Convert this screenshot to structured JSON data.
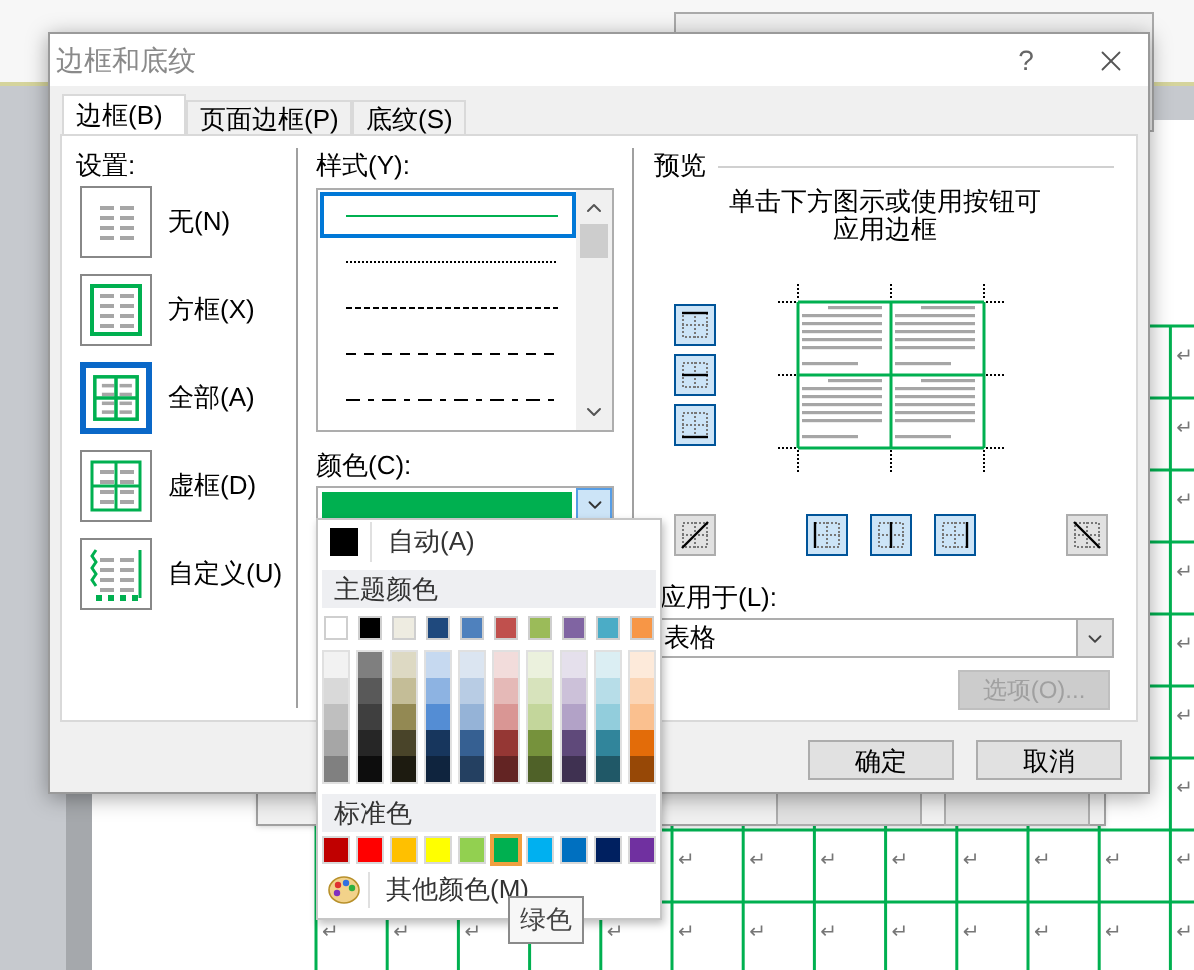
{
  "window": {
    "title": "边框和底纹",
    "help": "?"
  },
  "tabs": [
    {
      "label": "边框(B)",
      "selected": true
    },
    {
      "label": "页面边框(P)",
      "selected": false
    },
    {
      "label": "底纹(S)",
      "selected": false
    }
  ],
  "settings": {
    "label": "设置:",
    "items": [
      {
        "kind": "none",
        "label": "无(N)",
        "selected": false
      },
      {
        "kind": "box",
        "label": "方框(X)",
        "selected": false
      },
      {
        "kind": "all",
        "label": "全部(A)",
        "selected": true
      },
      {
        "kind": "grid",
        "label": "虚框(D)",
        "selected": false
      },
      {
        "kind": "custom",
        "label": "自定义(U)",
        "selected": false
      }
    ]
  },
  "style": {
    "label": "样式(Y):",
    "lines": [
      {
        "kind": "solid",
        "selected": true
      },
      {
        "kind": "dotted",
        "selected": false
      },
      {
        "kind": "fine-dash",
        "selected": false
      },
      {
        "kind": "dashed",
        "selected": false
      },
      {
        "kind": "dash-dot",
        "selected": false
      }
    ]
  },
  "color": {
    "label": "颜色(C):",
    "color": "#00b050"
  },
  "preview": {
    "label": "预览",
    "instruction": [
      "单击下方图示或使用按钮可",
      "应用边框"
    ],
    "side_buttons": [
      {
        "kind": "top",
        "pressed": true
      },
      {
        "kind": "inside-horizontal",
        "pressed": true
      },
      {
        "kind": "bottom",
        "pressed": true
      }
    ],
    "bottom_buttons": [
      {
        "kind": "diagonal-up",
        "pressed": false
      },
      {
        "kind": "left",
        "pressed": true
      },
      {
        "kind": "inside-vertical",
        "pressed": true
      },
      {
        "kind": "right",
        "pressed": true
      },
      {
        "kind": "diagonal-down",
        "pressed": false
      }
    ]
  },
  "apply_to": {
    "label": "应用于(L):",
    "value": "表格"
  },
  "options_button": {
    "label": "选项(O)...",
    "disabled": true
  },
  "buttons": [
    "确定",
    "取消"
  ],
  "color_menu": {
    "auto": {
      "label": "自动(A)",
      "color": "#000000"
    },
    "theme_label": "主题颜色",
    "theme": [
      {
        "color": "#ffffff",
        "shades": [
          {
            "color": "#f2f2f2"
          },
          {
            "color": "#d9d9d9"
          },
          {
            "color": "#bfbfbf"
          },
          {
            "color": "#a6a6a6"
          },
          {
            "color": "#808080"
          }
        ]
      },
      {
        "color": "#000000",
        "shades": [
          {
            "color": "#7f7f7f"
          },
          {
            "color": "#595959"
          },
          {
            "color": "#3f3f3f"
          },
          {
            "color": "#262626"
          },
          {
            "color": "#0d0d0d"
          }
        ]
      },
      {
        "color": "#eeece1",
        "shades": [
          {
            "color": "#ddd9c3"
          },
          {
            "color": "#c4bd97"
          },
          {
            "color": "#938953"
          },
          {
            "color": "#494429"
          },
          {
            "color": "#1d1b10"
          }
        ]
      },
      {
        "color": "#1f497d",
        "shades": [
          {
            "color": "#c6d9f0"
          },
          {
            "color": "#8db3e2"
          },
          {
            "color": "#548dd4"
          },
          {
            "color": "#17365d"
          },
          {
            "color": "#0f243e"
          }
        ]
      },
      {
        "color": "#4f81bd",
        "shades": [
          {
            "color": "#dbe5f1"
          },
          {
            "color": "#b8cce4"
          },
          {
            "color": "#95b3d7"
          },
          {
            "color": "#366092"
          },
          {
            "color": "#244061"
          }
        ]
      },
      {
        "color": "#c0504d",
        "shades": [
          {
            "color": "#f2dcdb"
          },
          {
            "color": "#e5b9b7"
          },
          {
            "color": "#d99694"
          },
          {
            "color": "#953734"
          },
          {
            "color": "#632423"
          }
        ]
      },
      {
        "color": "#9bbb59",
        "shades": [
          {
            "color": "#ebf1dd"
          },
          {
            "color": "#d7e3bc"
          },
          {
            "color": "#c3d69b"
          },
          {
            "color": "#76923c"
          },
          {
            "color": "#4f6128"
          }
        ]
      },
      {
        "color": "#8064a2",
        "shades": [
          {
            "color": "#e5e0ec"
          },
          {
            "color": "#ccc1d9"
          },
          {
            "color": "#b2a2c7"
          },
          {
            "color": "#5f497a"
          },
          {
            "color": "#3f3151"
          }
        ]
      },
      {
        "color": "#4bacc6",
        "shades": [
          {
            "color": "#dbeef3"
          },
          {
            "color": "#b7dde8"
          },
          {
            "color": "#92cddc"
          },
          {
            "color": "#31859b"
          },
          {
            "color": "#205867"
          }
        ]
      },
      {
        "color": "#f79646",
        "shades": [
          {
            "color": "#fdeada"
          },
          {
            "color": "#fbd5b5"
          },
          {
            "color": "#fac08f"
          },
          {
            "color": "#e36c09"
          },
          {
            "color": "#974806"
          }
        ]
      }
    ],
    "standard_label": "标准色",
    "standard": [
      {
        "color": "#c00000",
        "selected": false
      },
      {
        "color": "#ff0000",
        "selected": false
      },
      {
        "color": "#ffc000",
        "selected": false
      },
      {
        "color": "#ffff00",
        "selected": false
      },
      {
        "color": "#92d050",
        "selected": false
      },
      {
        "color": "#00b050",
        "selected": true
      },
      {
        "color": "#00b0f0",
        "selected": false
      },
      {
        "color": "#0070c0",
        "selected": false
      },
      {
        "color": "#002060",
        "selected": false
      },
      {
        "color": "#7030a0",
        "selected": false
      }
    ],
    "more": "其他颜色(M)"
  },
  "tooltip": "绿色",
  "document_table": {
    "rows": [
      {
        "cells": [
          {},
          {},
          {},
          {},
          {},
          {},
          {},
          {},
          {},
          {},
          {},
          {},
          {
            "text": "↵"
          }
        ]
      },
      {
        "cells": [
          {},
          {},
          {},
          {},
          {},
          {},
          {},
          {},
          {},
          {},
          {},
          {},
          {
            "text": "↵"
          }
        ]
      },
      {
        "cells": [
          {},
          {},
          {},
          {},
          {},
          {},
          {},
          {},
          {},
          {},
          {},
          {},
          {
            "text": "↵"
          }
        ]
      },
      {
        "cells": [
          {},
          {},
          {},
          {},
          {},
          {},
          {},
          {},
          {},
          {},
          {},
          {},
          {
            "text": "↵"
          }
        ]
      },
      {
        "cells": [
          {},
          {},
          {},
          {},
          {},
          {},
          {},
          {},
          {},
          {},
          {},
          {},
          {
            "text": "↵"
          }
        ]
      },
      {
        "cells": [
          {},
          {},
          {},
          {},
          {},
          {},
          {},
          {},
          {},
          {},
          {},
          {},
          {
            "text": "↵"
          }
        ]
      },
      {
        "cells": [
          {},
          {},
          {},
          {},
          {},
          {},
          {},
          {},
          {},
          {},
          {},
          {},
          {
            "text": "↵"
          }
        ]
      },
      {
        "cells": [
          {},
          {},
          {},
          {},
          {},
          {
            "text": "↵"
          },
          {
            "text": "↵"
          },
          {
            "text": "↵"
          },
          {
            "text": "↵"
          },
          {
            "text": "↵"
          },
          {
            "text": "↵"
          },
          {
            "text": "↵"
          },
          {
            "text": "↵"
          }
        ]
      },
      {
        "cells": [
          {
            "text": "↵"
          },
          {
            "text": "↵"
          },
          {
            "text": "↵"
          },
          {},
          {
            "text": "↵"
          },
          {
            "text": "↵"
          },
          {
            "text": "↵"
          },
          {
            "text": "↵"
          },
          {
            "text": "↵"
          },
          {
            "text": "↵"
          },
          {
            "text": "↵"
          },
          {
            "text": "↵"
          },
          {
            "text": "↵"
          }
        ]
      }
    ]
  }
}
